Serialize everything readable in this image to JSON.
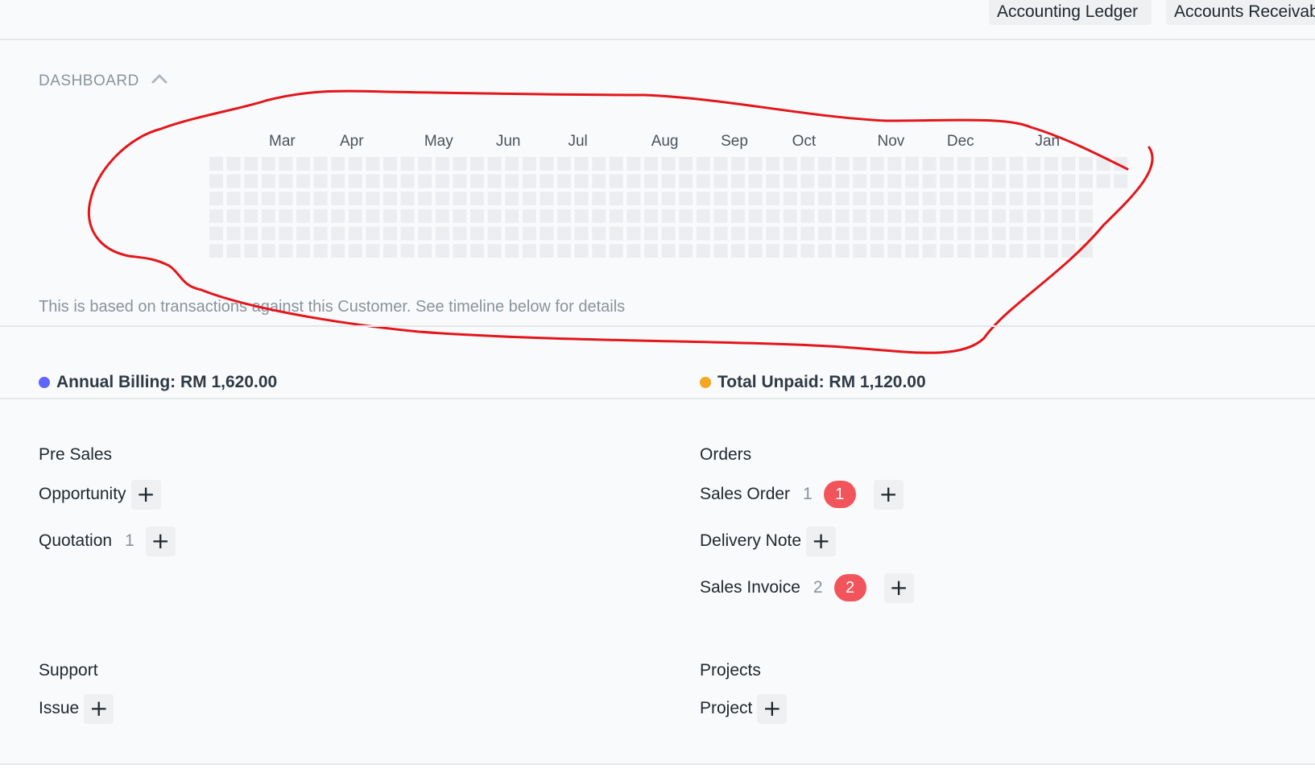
{
  "top_buttons": {
    "ledger": "Accounting Ledger",
    "receivable": "Accounts Receivab"
  },
  "dashboard": {
    "title": "DASHBOARD",
    "months": [
      "Mar",
      "Apr",
      "May",
      "Jun",
      "Jul",
      "Aug",
      "Sep",
      "Oct",
      "Nov",
      "Dec",
      "Jan"
    ],
    "note": "This is based on transactions against this Customer. See timeline below for details",
    "heatmap_color": "#ebedf0",
    "annotation_color": "#e3161b"
  },
  "stats": {
    "annual_billing": "Annual Billing: RM 1,620.00",
    "annual_billing_color": "#5e64ff",
    "total_unpaid": "Total Unpaid: RM 1,120.00",
    "total_unpaid_color": "#f5a623"
  },
  "pre_sales": {
    "title": "Pre Sales",
    "opportunity": "Opportunity",
    "quotation": "Quotation",
    "quotation_count": "1"
  },
  "orders": {
    "title": "Orders",
    "sales_order": "Sales Order",
    "sales_order_count": "1",
    "sales_order_badge": "1",
    "delivery_note": "Delivery Note",
    "sales_invoice": "Sales Invoice",
    "sales_invoice_count": "2",
    "sales_invoice_badge": "2"
  },
  "support": {
    "title": "Support",
    "issue": "Issue"
  },
  "projects": {
    "title": "Projects",
    "project": "Project"
  },
  "plus_symbol": "+"
}
